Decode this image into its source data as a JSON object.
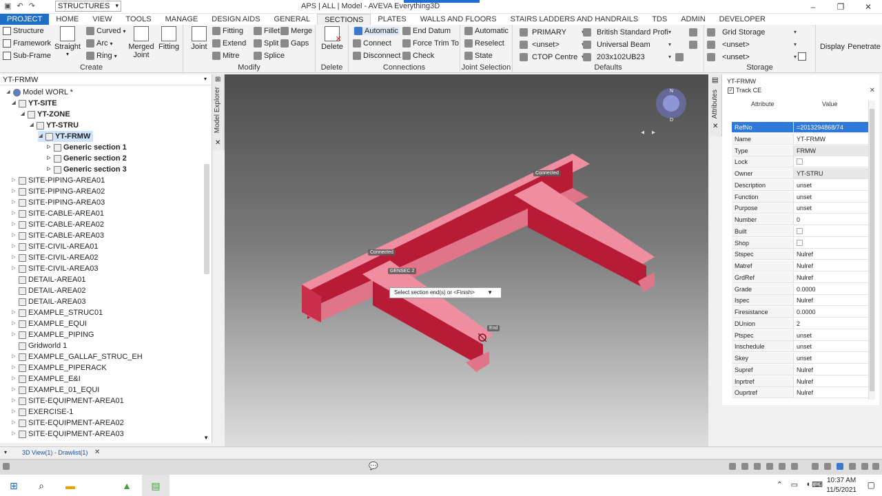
{
  "title_bar": {
    "title": "APS | ALL | Model - AVEVA Everything3D",
    "module_select": "STRUCTURES"
  },
  "ribbon_tabs": [
    "PROJECT",
    "HOME",
    "VIEW",
    "TOOLS",
    "MANAGE",
    "DESIGN AIDS",
    "GENERAL",
    "SECTIONS",
    "PLATES",
    "WALLS AND FLOORS",
    "STAIRS LADDERS AND HANDRAILS",
    "TDS",
    "ADMIN",
    "DEVELOPER"
  ],
  "ribbon": {
    "create": {
      "label": "Create",
      "structure": "Structure",
      "framework": "Framework",
      "subframe": "Sub-Frame",
      "straight": "Straight",
      "curved": "Curved",
      "arc": "Arc",
      "ring": "Ring",
      "merged_joint": "Merged Joint",
      "fitting": "Fitting"
    },
    "modify": {
      "label": "Modify",
      "joint": "Joint",
      "fitting": "Fitting",
      "extend": "Extend",
      "mitre": "Mitre",
      "fillet": "Fillet",
      "split": "Split",
      "splice": "Splice",
      "merge": "Merge",
      "gaps": "Gaps"
    },
    "delete": {
      "label": "Delete",
      "button": "Delete"
    },
    "connections": {
      "label": "Connections",
      "automatic": "Automatic",
      "connect": "Connect",
      "disconnect": "Disconnect",
      "end_datum": "End Datum",
      "force_trim": "Force Trim To",
      "check": "Check"
    },
    "joint_selection": {
      "label": "Joint Selection",
      "automatic": "Automatic",
      "reselect": "Reselect",
      "state": "State"
    },
    "defaults": {
      "label": "Defaults",
      "primary": "PRIMARY",
      "unset": "<unset>",
      "ctop": "CTOP Centre",
      "spec": "British Standard Profi",
      "type": "Universal Beam",
      "size": "203x102UB23"
    },
    "storage": {
      "label": "Storage",
      "grid": "Grid Storage",
      "unset1": "<unset>",
      "unset2": "<unset>"
    },
    "display": "Display",
    "penetrate": "Penetrate"
  },
  "tree": {
    "header": "YT-FRMW",
    "nodes": [
      "Model WORL *",
      "YT-SITE",
      "YT-ZONE",
      "YT-STRU",
      "YT-FRMW",
      "Generic section 1",
      "Generic section 2",
      "Generic section 3",
      "SITE-PIPING-AREA01",
      "SITE-PIPING-AREA02",
      "SITE-PIPING-AREA03",
      "SITE-CABLE-AREA01",
      "SITE-CABLE-AREA02",
      "SITE-CABLE-AREA03",
      "SITE-CIVIL-AREA01",
      "SITE-CIVIL-AREA02",
      "SITE-CIVIL-AREA03",
      "DETAIL-AREA01",
      "DETAIL-AREA02",
      "DETAIL-AREA03",
      "EXAMPLE_STRUC01",
      "EXAMPLE_EQUI",
      "EXAMPLE_PIPING",
      "Gridworld 1",
      "EXAMPLE_GALLAF_STRUC_EH",
      "EXAMPLE_PIPERACK",
      "EXAMPLE_E&I",
      "EXAMPLE_01_EQUI",
      "SITE-EQUIPMENT-AREA01",
      "EXERCISE-1",
      "SITE-EQUIPMENT-AREA02",
      "SITE-EQUIPMENT-AREA03"
    ]
  },
  "model_explorer_label": "Model Explorer",
  "viewport": {
    "tags": {
      "connected1": "Connected",
      "connected2": "Connected",
      "gensec": "GENSEC 2",
      "end": "End"
    },
    "prompt": "Select section end(s) or <Finish>",
    "beam_color": "#d8304a"
  },
  "doc_tab": "3D View(1) - Drawlist(1)",
  "attributes": {
    "strip_label": "Attributes",
    "title": "YT-FRMW",
    "track_ce": "Track CE",
    "col_attr": "Attribute",
    "col_value": "Value",
    "rows": [
      {
        "k": "RefNo",
        "v": "=2013294868/74"
      },
      {
        "k": "Name",
        "v": "YT-FRMW"
      },
      {
        "k": "Type",
        "v": "FRMW"
      },
      {
        "k": "Lock",
        "v": ""
      },
      {
        "k": "Owner",
        "v": "YT-STRU"
      },
      {
        "k": "Description",
        "v": "unset"
      },
      {
        "k": "Function",
        "v": "unset"
      },
      {
        "k": "Purpose",
        "v": "unset"
      },
      {
        "k": "Number",
        "v": "0"
      },
      {
        "k": "Built",
        "v": ""
      },
      {
        "k": "Shop",
        "v": ""
      },
      {
        "k": "Stspec",
        "v": "Nulref"
      },
      {
        "k": "Matref",
        "v": "Nulref"
      },
      {
        "k": "GrdRef",
        "v": "Nulref"
      },
      {
        "k": "Grade",
        "v": "0.0000"
      },
      {
        "k": "Ispec",
        "v": "Nulref"
      },
      {
        "k": "Firesistance",
        "v": "0.0000"
      },
      {
        "k": "DUnion",
        "v": "2"
      },
      {
        "k": "Ptspec",
        "v": "unset"
      },
      {
        "k": "Inschedule",
        "v": "unset"
      },
      {
        "k": "Skey",
        "v": "unset"
      },
      {
        "k": "Supref",
        "v": "Nulref"
      },
      {
        "k": "Inprtref",
        "v": "Nulref"
      },
      {
        "k": "Ouprtref",
        "v": "Nulref"
      }
    ]
  },
  "taskbar": {
    "time": "10:37 AM",
    "date": "11/5/2021"
  }
}
